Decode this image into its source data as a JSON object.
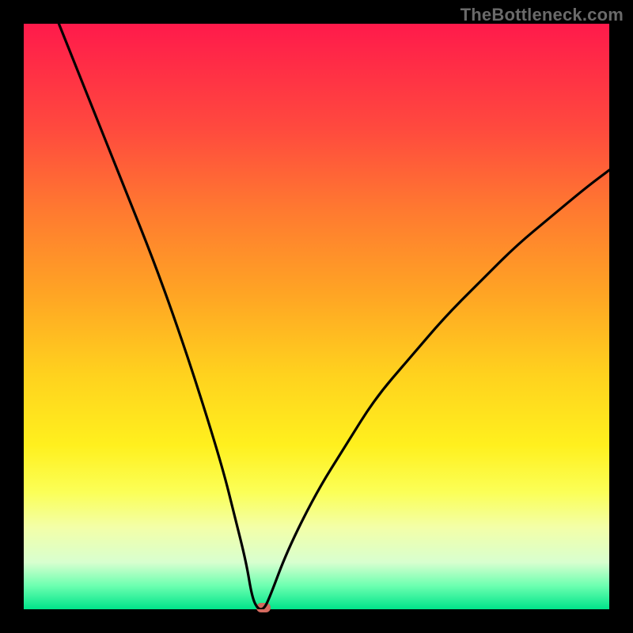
{
  "watermark": "TheBottleneck.com",
  "colors": {
    "frame": "#000000",
    "curve": "#000000",
    "marker": "#d46a5f",
    "gradient_top": "#ff1a4b",
    "gradient_bottom": "#00e48a"
  },
  "chart_data": {
    "type": "line",
    "title": "",
    "xlabel": "",
    "ylabel": "",
    "xlim": [
      0,
      100
    ],
    "ylim": [
      0,
      100
    ],
    "grid": false,
    "legend": false,
    "x": [
      6,
      10,
      14,
      18,
      22,
      26,
      30,
      34,
      36,
      38,
      39,
      40,
      41,
      42,
      45,
      50,
      55,
      60,
      66,
      72,
      78,
      84,
      90,
      96,
      100
    ],
    "values": [
      100,
      90,
      80,
      70,
      60,
      49,
      37,
      24,
      16,
      8,
      2,
      0,
      0,
      2,
      10,
      20,
      28,
      36,
      43,
      50,
      56,
      62,
      67,
      72,
      75
    ],
    "marker": {
      "x": 41,
      "y": 0
    },
    "annotations": []
  }
}
